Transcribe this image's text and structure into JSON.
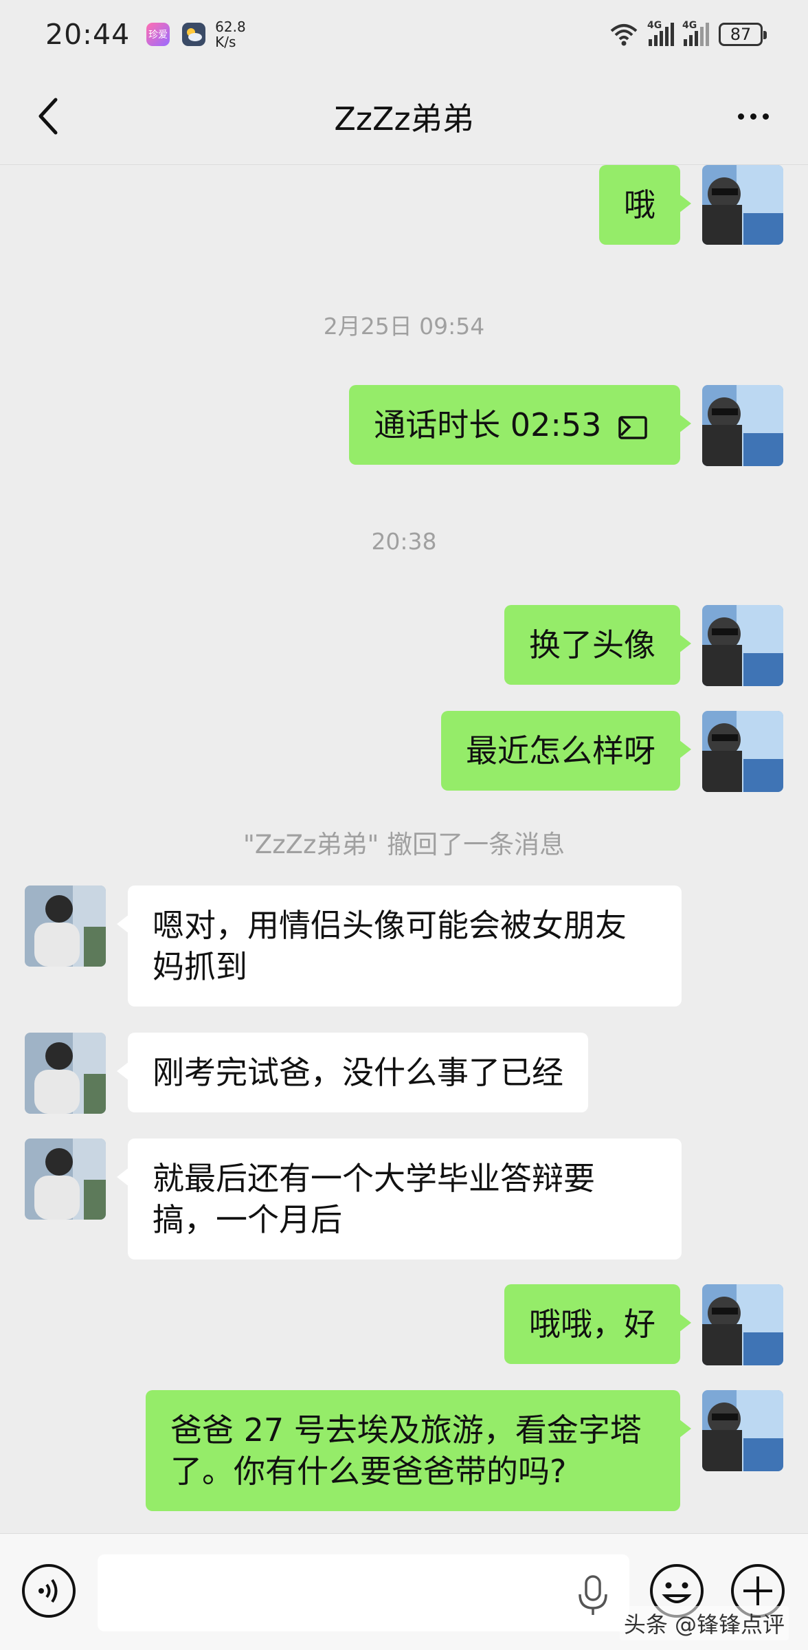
{
  "status_bar": {
    "time": "20:44",
    "app_badge": "珍爱",
    "net_speed_value": "62.8",
    "net_speed_unit": "K/s",
    "signal1_label": "4G",
    "signal2_label": "4G",
    "battery": "87"
  },
  "header": {
    "title": "ZzZz弟弟"
  },
  "messages": {
    "m1": "哦",
    "t1": "2月25日 09:54",
    "m2": "通话时长 02:53",
    "t2": "20:38",
    "m3": "换了头像",
    "m4": "最近怎么样呀",
    "recall": "\"ZzZz弟弟\" 撤回了一条消息",
    "m5": "嗯对，用情侣头像可能会被女朋友妈抓到",
    "m6": "刚考完试爸，没什么事了已经",
    "m7": "就最后还有一个大学毕业答辩要搞，一个月后",
    "m8": "哦哦，好",
    "m9": "爸爸 27 号去埃及旅游，看金字塔了。你有什么要爸爸带的吗?"
  },
  "watermark": "头条 @锋锋点评",
  "colors": {
    "background": "#ededed",
    "my_bubble": "#95ec69",
    "other_bubble": "#ffffff",
    "meta_text": "#a0a0a0"
  },
  "icons": {
    "back": "chevron-left-icon",
    "more": "more-dots-icon",
    "call": "video-call-icon",
    "voice": "voice-mode-icon",
    "mic": "microphone-icon",
    "emoji": "emoji-icon",
    "plus": "plus-icon"
  }
}
